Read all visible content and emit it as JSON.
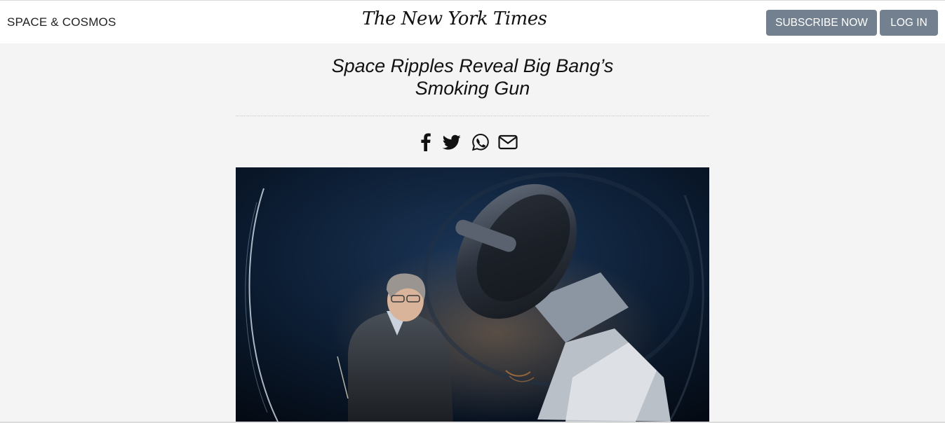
{
  "header": {
    "section_label": "SPACE & COSMOS",
    "logo_text": "The New York Times",
    "subscribe_label": "SUBSCRIBE NOW",
    "login_label": "LOG IN",
    "button_color": "#728090"
  },
  "article": {
    "headline_line1": "Space Ripples Reveal Big Bang’s",
    "headline_line2": "Smoking Gun",
    "share_icons": [
      "facebook-icon",
      "twitter-icon",
      "whatsapp-icon",
      "email-icon"
    ],
    "photo_alt": "Scientist standing beside a large telescope at night"
  }
}
